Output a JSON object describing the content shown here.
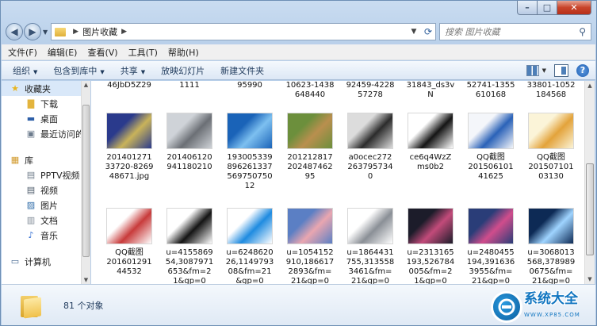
{
  "window": {
    "caption": {
      "minimize": "–",
      "maximize": "□",
      "close": "✕"
    }
  },
  "address": {
    "back_icon": "back-arrow-icon",
    "forward_icon": "forward-arrow-icon",
    "path": [
      "图片收藏"
    ],
    "search_placeholder": "搜索 图片收藏"
  },
  "menu": [
    "文件(F)",
    "编辑(E)",
    "查看(V)",
    "工具(T)",
    "帮助(H)"
  ],
  "commands": [
    {
      "label": "组织",
      "dropdown": true
    },
    {
      "label": "包含到库中",
      "dropdown": true
    },
    {
      "label": "共享",
      "dropdown": true
    },
    {
      "label": "放映幻灯片",
      "dropdown": false
    },
    {
      "label": "新建文件夹",
      "dropdown": false
    }
  ],
  "nav": [
    {
      "label": "收藏夹",
      "level": 0,
      "icon": "star-icon",
      "selected": true
    },
    {
      "label": "下载",
      "level": 1,
      "icon": "download-folder-icon"
    },
    {
      "label": "桌面",
      "level": 1,
      "icon": "desktop-icon"
    },
    {
      "label": "最近访问的",
      "level": 1,
      "icon": "recent-places-icon"
    },
    {
      "gap": true
    },
    {
      "label": "库",
      "level": 0,
      "icon": "library-icon"
    },
    {
      "label": "PPTV视频",
      "level": 1,
      "icon": "pptv-library-icon"
    },
    {
      "label": "视频",
      "level": 1,
      "icon": "video-library-icon"
    },
    {
      "label": "图片",
      "level": 1,
      "icon": "pictures-library-icon"
    },
    {
      "label": "文档",
      "level": 1,
      "icon": "documents-library-icon"
    },
    {
      "label": "音乐",
      "level": 1,
      "icon": "music-library-icon"
    },
    {
      "gap": true
    },
    {
      "label": "计算机",
      "level": 0,
      "icon": "computer-icon"
    }
  ],
  "files_row0": [
    "46JbD5Z29",
    "1111",
    "95990",
    "10623-1438\n648440",
    "92459-4228\n57278",
    "31843_ds3v\nN",
    "52741-1355\n610168",
    "33801-1052\n184568"
  ],
  "files": [
    {
      "label": "201401271\n33720-8269\n48671.jpg",
      "thumb": "sd-card-thumbnail",
      "colors": [
        "#2a3a8c",
        "#c9b35a"
      ]
    },
    {
      "label": "201406120\n941180210",
      "thumb": "laptop-keyboard-thumbnail",
      "colors": [
        "#cfd3d8",
        "#6b6f75"
      ]
    },
    {
      "label": "193005339\n896261337\n569750750\n12",
      "thumb": "windows7-wallpaper-thumbnail",
      "colors": [
        "#1a63b8",
        "#7dc0f0"
      ]
    },
    {
      "label": "201212817\n202487462\n95",
      "thumb": "game-map-thumbnail",
      "colors": [
        "#6c8f3c",
        "#b98f4e"
      ]
    },
    {
      "label": "a0ocec272\n263795734\n0",
      "thumb": "camera-lens-thumbnail",
      "colors": [
        "#dcdcdc",
        "#2c2c2c"
      ]
    },
    {
      "label": "ce6q4WzZ\nms0b2",
      "thumb": "mouse-thumbnail",
      "colors": [
        "#ffffff",
        "#151515"
      ]
    },
    {
      "label": "QQ截图\n201506101\n41625",
      "thumb": "network-cable-thumbnail",
      "colors": [
        "#f4f6fa",
        "#2b62b8"
      ]
    },
    {
      "label": "QQ截图\n201507101\n03130",
      "thumb": "document-screenshot-thumbnail",
      "colors": [
        "#fbf4d8",
        "#e3a33b"
      ]
    },
    {
      "label": "QQ截图\n201601291\n44532",
      "thumb": "spreadsheet-screenshot-thumbnail",
      "colors": [
        "#ffffff",
        "#c83b3b"
      ]
    },
    {
      "label": "u=4155869\n54,3087971\n653&fm=2\n1&gp=0",
      "thumb": "black-laptop-thumbnail",
      "colors": [
        "#ffffff",
        "#141414"
      ]
    },
    {
      "label": "u=6248620\n26,1149793\n08&fm=21\n&gp=0",
      "thumb": "ie-logo-thumbnail",
      "colors": [
        "#ffffff",
        "#1f8be0"
      ]
    },
    {
      "label": "u=1054152\n910,186617\n2893&fm=\n21&gp=0",
      "thumb": "anime-sky-thumbnail",
      "colors": [
        "#5b7fc4",
        "#e9a6b0"
      ]
    },
    {
      "label": "u=1864431\n755,313558\n3461&fm=\n21&gp=0",
      "thumb": "usb-drive-thumbnail",
      "colors": [
        "#ffffff",
        "#8a8f96"
      ]
    },
    {
      "label": "u=2313165\n193,526784\n005&fm=2\n1&gp=0",
      "thumb": "phone-apps-thumbnail",
      "colors": [
        "#1c1c2a",
        "#c24b7a"
      ]
    },
    {
      "label": "u=2480455\n194,391636\n3955&fm=\n21&gp=0",
      "thumb": "windows-tiles-thumbnail",
      "colors": [
        "#2a3d78",
        "#d04d8c"
      ]
    },
    {
      "label": "u=3068013\n568,378989\n0675&fm=\n21&gp=0",
      "thumb": "blue-light-thumbnail",
      "colors": [
        "#0d2a55",
        "#9fd4ff"
      ]
    }
  ],
  "details": {
    "count": "81 个对象"
  },
  "watermark": {
    "text": "系统大全",
    "sub": "WWW.XP85.COM"
  }
}
